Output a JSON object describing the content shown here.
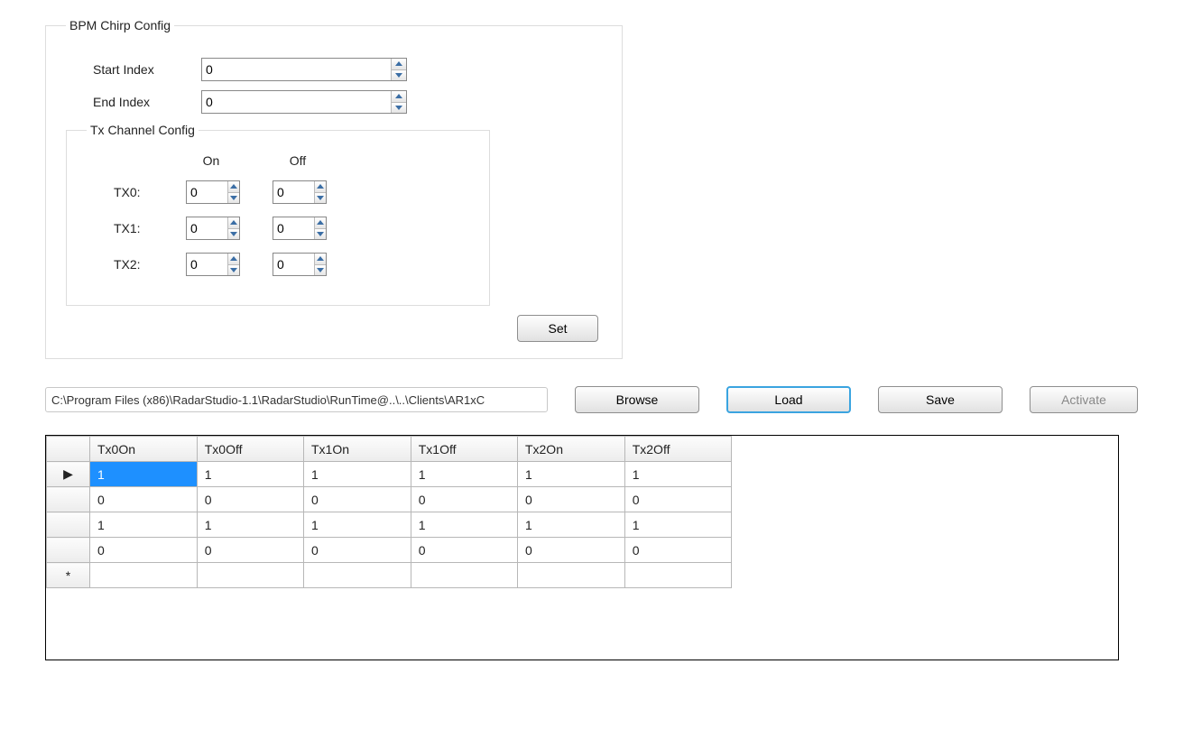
{
  "bpm": {
    "legend": "BPM Chirp Config",
    "start_label": "Start Index",
    "start_value": "0",
    "end_label": "End Index",
    "end_value": "0"
  },
  "txcfg": {
    "legend": "Tx Channel Config",
    "on_header": "On",
    "off_header": "Off",
    "rows": [
      {
        "label": "TX0:",
        "on": "0",
        "off": "0"
      },
      {
        "label": "TX1:",
        "on": "0",
        "off": "0"
      },
      {
        "label": "TX2:",
        "on": "0",
        "off": "0"
      }
    ],
    "set_label": "Set"
  },
  "file": {
    "path": "C:\\Program Files (x86)\\RadarStudio-1.1\\RadarStudio\\RunTime@..\\..\\Clients\\AR1xC",
    "browse": "Browse",
    "load": "Load",
    "save": "Save",
    "activate": "Activate"
  },
  "table": {
    "columns": [
      "Tx0On",
      "Tx0Off",
      "Tx1On",
      "Tx1Off",
      "Tx2On",
      "Tx2Off"
    ],
    "current_marker": "▶",
    "new_marker": "*",
    "rows": [
      [
        "1",
        "1",
        "1",
        "1",
        "1",
        "1"
      ],
      [
        "0",
        "0",
        "0",
        "0",
        "0",
        "0"
      ],
      [
        "1",
        "1",
        "1",
        "1",
        "1",
        "1"
      ],
      [
        "0",
        "0",
        "0",
        "0",
        "0",
        "0"
      ]
    ],
    "selected": {
      "row": 0,
      "col": 0
    }
  }
}
